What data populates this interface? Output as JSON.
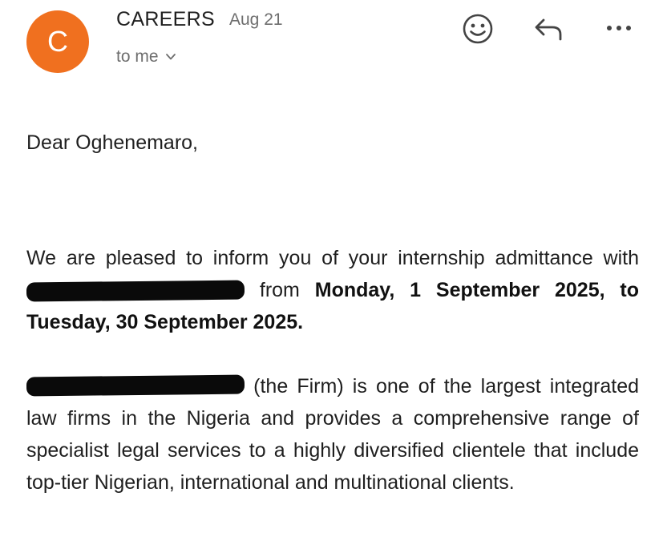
{
  "header": {
    "avatar_letter": "C",
    "avatar_color": "#f0701f",
    "sender": "CAREERS",
    "date": "Aug 21",
    "recipient": "to me",
    "icons": [
      "emoji-icon",
      "reply-icon",
      "more-icon"
    ]
  },
  "message": {
    "greeting": "Dear Oghenemaro,",
    "para1": {
      "t1": "We are pleased to inform you of your internship admittance with",
      "t2": "from",
      "bold": "Monday, 1 September 2025, to Tuesday, 30 September 2025."
    },
    "para2": {
      "t1": "(the Firm) is one of the largest integrated law firms in the Nigeria and provides a comprehensive range of specialist legal services to a highly diversified clientele that include top-tier Nigerian, international and multinational clients."
    }
  }
}
